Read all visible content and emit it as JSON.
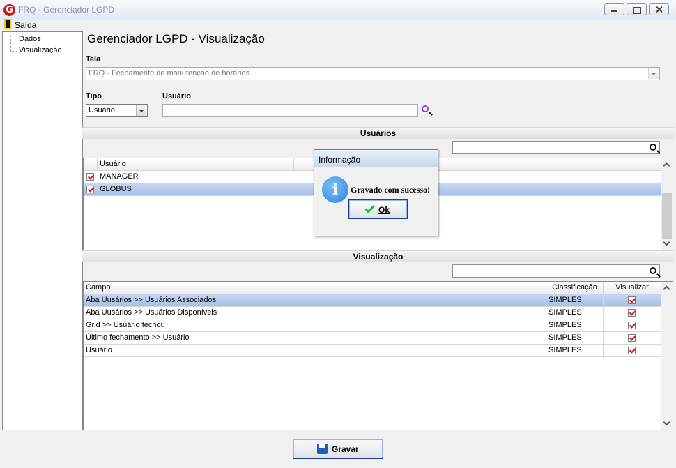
{
  "window": {
    "title": "FRQ - Gerenciador LGPD",
    "logo": "G"
  },
  "menu": {
    "exit_label": "Saída"
  },
  "tree": {
    "items": [
      {
        "label": "Dados"
      },
      {
        "label": "Visualização"
      }
    ]
  },
  "page": {
    "title": "Gerenciador LGPD - Visualização"
  },
  "form": {
    "screen_label": "Tela",
    "screen_value": "FRQ - Fechamento de manutenção de horários",
    "type_label": "Tipo",
    "type_value": "Usuário",
    "user_label": "Usuário",
    "user_value": ""
  },
  "users_section": {
    "title": "Usuários",
    "search_value": "",
    "column": "Usuário",
    "rows": [
      {
        "name": "MANAGER",
        "checked": true
      },
      {
        "name": "GLOBUS",
        "checked": true,
        "selected": true
      }
    ]
  },
  "view_section": {
    "title": "Visualização",
    "search_value": "",
    "columns": {
      "field": "Campo",
      "classification": "Classificação",
      "view": "Visualizar"
    },
    "rows": [
      {
        "field": "Aba Uusários >> Usuários Associados",
        "classification": "SIMPLES",
        "view": true,
        "selected": true
      },
      {
        "field": "Aba Uusários >> Usuários Disponíveis",
        "classification": "SIMPLES",
        "view": true
      },
      {
        "field": "Grid >> Usuário fechou",
        "classification": "SIMPLES",
        "view": true
      },
      {
        "field": "Último fechamento >> Usuário",
        "classification": "SIMPLES",
        "view": true
      },
      {
        "field": "Usuário",
        "classification": "SIMPLES",
        "view": true
      }
    ]
  },
  "save_button": {
    "label": "Gravar"
  },
  "dialog": {
    "title": "Informação",
    "message": "Gravado com sucesso!",
    "ok_label": "Ok",
    "icon": "info-icon"
  },
  "colors": {
    "accent": "#2a84dc",
    "selected_row": "#a8bfe8",
    "check": "#cc1010"
  }
}
